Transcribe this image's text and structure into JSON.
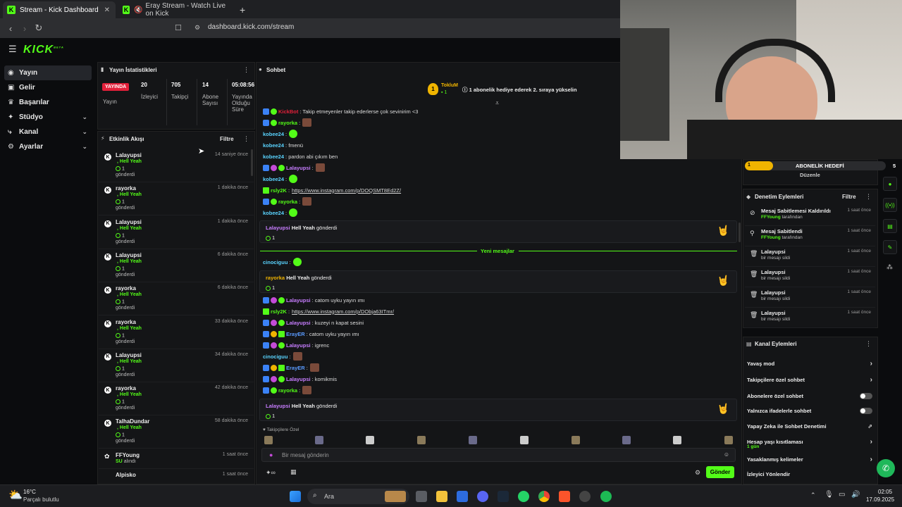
{
  "browser": {
    "tabs": [
      {
        "label": "Stream - Kick Dashboard",
        "active": true
      },
      {
        "label": "Eray Stream - Watch Live on Kick",
        "active": false
      }
    ],
    "url": "dashboard.kick.com/stream"
  },
  "app": {
    "logo": "KICK",
    "logo_sup": "BETA"
  },
  "sidebar": {
    "items": [
      {
        "label": "Yayın",
        "icon": "broadcast-icon",
        "active": true
      },
      {
        "label": "Gelir",
        "icon": "revenue-icon"
      },
      {
        "label": "Başarılar",
        "icon": "trophy-icon"
      },
      {
        "label": "Stüdyo",
        "icon": "studio-icon",
        "chevron": true
      },
      {
        "label": "Kanal",
        "icon": "channel-icon",
        "chevron": true
      },
      {
        "label": "Ayarlar",
        "icon": "gear-icon",
        "chevron": true
      }
    ]
  },
  "stats": {
    "title": "Yayın İstatistikleri",
    "live_badge": "YAYINDA",
    "live_label": "Yayın",
    "viewers": {
      "value": "20",
      "label": "İzleyici"
    },
    "followers": {
      "value": "705",
      "label": "Takipçi"
    },
    "subs": {
      "value": "14",
      "label1": "Abone",
      "label2": "Sayısı"
    },
    "uptime": {
      "value": "05:08:56",
      "label1": "Yayında",
      "label2": "Olduğu",
      "label3": "Süre"
    }
  },
  "activity": {
    "title": "Etkinlik Akışı",
    "filter": "Filtre",
    "rows": [
      {
        "name": "Lalayupsi",
        "sub": ", Hell Yeah",
        "count": "1",
        "sent": "gönderdi",
        "time": "14 saniye önce"
      },
      {
        "name": "rayorka",
        "sub": ", Hell Yeah",
        "count": "1",
        "sent": "gönderdi",
        "time": "1 dakika önce"
      },
      {
        "name": "Lalayupsi",
        "sub": ", Hell Yeah",
        "count": "1",
        "sent": "gönderdi",
        "time": "1 dakika önce"
      },
      {
        "name": "Lalayupsi",
        "sub": ", Hell Yeah",
        "count": "1",
        "sent": "gönderdi",
        "time": "6 dakika önce"
      },
      {
        "name": "rayorka",
        "sub": ", Hell Yeah",
        "count": "1",
        "sent": "gönderdi",
        "time": "6 dakika önce"
      },
      {
        "name": "rayorka",
        "sub": ", Hell Yeah",
        "count": "1",
        "sent": "gönderdi",
        "time": "33 dakika önce"
      },
      {
        "name": "Lalayupsi",
        "sub": ", Hell Yeah",
        "count": "1",
        "sent": "gönderdi",
        "time": "34 dakika önce"
      },
      {
        "name": "rayorka",
        "sub": ", Hell Yeah",
        "count": "1",
        "sent": "gönderdi",
        "time": "42 dakika önce"
      },
      {
        "name": "TalhaDundar",
        "sub": ", Hell Yeah",
        "count": "1",
        "sent": "gönderdi",
        "time": "58 dakika önce"
      }
    ],
    "ffyoung": {
      "name": "FFYoung",
      "sub": "SU",
      "sub2": "alındı",
      "time": "1 saat önce"
    },
    "alpisko": {
      "name": "Alpisko",
      "time": "1 saat önce"
    }
  },
  "chat": {
    "title": "Sohbet",
    "pinned": {
      "user": "TokluM",
      "count": "1",
      "text": "1 abonelik hediye ederek 2. sıraya yükselin"
    },
    "lines": [
      {
        "user": "KickBot",
        "color": "#e2203a",
        "text": ": Takip etmeyenler takip ederlerse çok sevinirim <3",
        "badges": [
          "b-blue",
          "b-green"
        ]
      },
      {
        "user": "rayorka",
        "color": "#53fc18",
        "text": ":",
        "badges": [
          "b-blue",
          "b-green"
        ],
        "emote": "brown"
      },
      {
        "user": "kobee24",
        "color": "#5ad4ff",
        "text": ":",
        "badges": [],
        "emote": "green"
      },
      {
        "user": "kobee24",
        "color": "#5ad4ff",
        "text": ": fmenü",
        "badges": []
      },
      {
        "user": "kobee24",
        "color": "#5ad4ff",
        "text": ": pardon abi çıkım ben",
        "badges": []
      },
      {
        "user": "Lalayupsi",
        "color": "#c77dff",
        "text": ":",
        "badges": [
          "b-blue",
          "b-pink",
          "b-green"
        ],
        "emote": "brown"
      },
      {
        "user": "kobee24",
        "color": "#5ad4ff",
        "text": ":",
        "badges": [],
        "emote": "green"
      },
      {
        "user": "rsly2K",
        "color": "#53fc18",
        "text": ":",
        "badges": [
          "b-gift"
        ],
        "link": "https://www.instagram.com/p/DOQSMT8Ed2Z/"
      },
      {
        "user": "rayorka",
        "color": "#53fc18",
        "text": ":",
        "badges": [
          "b-blue",
          "b-green"
        ],
        "emote": "brown"
      },
      {
        "user": "kobee24",
        "color": "#5ad4ff",
        "text": ":",
        "badges": [],
        "emote": "green"
      }
    ],
    "gift1": {
      "user": "Lalayupsi",
      "item": "Hell Yeah",
      "sent": "gönderdi",
      "count": "1"
    },
    "new_messages": "Yeni mesajlar",
    "line_cino": {
      "user": "cinociguu",
      "color": "#5ad4ff",
      "text": ":"
    },
    "gift2": {
      "user": "rayorka",
      "item": "Hell Yeah",
      "sent": "gönderdi",
      "count": "1"
    },
    "lines2": [
      {
        "user": "Lalayupsi",
        "color": "#c77dff",
        "text": ": catom uyku yayın ımı",
        "badges": [
          "b-blue",
          "b-pink",
          "b-green"
        ]
      },
      {
        "user": "rsly2K",
        "color": "#53fc18",
        "text": ":",
        "badges": [
          "b-gift"
        ],
        "link": "https://www.instagram.com/p/DObja63ITmr/"
      },
      {
        "user": "Lalayupsi",
        "color": "#c77dff",
        "text": ": kuzeyi n kapat sesini",
        "badges": [
          "b-blue",
          "b-pink",
          "b-green"
        ]
      },
      {
        "user": "ErayER",
        "color": "#5a9bff",
        "text": ": catom uyku yayın ımı",
        "badges": [
          "b-blue",
          "b-gold",
          "b-gift"
        ]
      },
      {
        "user": "Lalayupsi",
        "color": "#c77dff",
        "text": ": igrenc",
        "badges": [
          "b-blue",
          "b-pink",
          "b-green"
        ]
      },
      {
        "user": "cinociguu",
        "color": "#5ad4ff",
        "text": ":",
        "badges": [],
        "emote": "brown"
      },
      {
        "user": "ErayER",
        "color": "#5a9bff",
        "text": ":",
        "badges": [
          "b-blue",
          "b-gold",
          "b-gift"
        ],
        "emote": "brown"
      },
      {
        "user": "Lalayupsi",
        "color": "#c77dff",
        "text": ": komikmis",
        "badges": [
          "b-blue",
          "b-pink",
          "b-green"
        ]
      },
      {
        "user": "rayorka",
        "color": "#53fc18",
        "text": ":",
        "badges": [
          "b-blue",
          "b-green"
        ],
        "emote": "brown"
      }
    ],
    "gift3": {
      "user": "Lalayupsi",
      "item": "Hell Yeah",
      "sent": "gönderdi",
      "count": "1"
    },
    "followers_only": "Takipçilere Özel",
    "input_placeholder": "Bir mesaj gönderin",
    "send": "Gönder"
  },
  "sub_goal": {
    "start": "1",
    "title": "ABONELİK HEDEFİ",
    "end": "5",
    "edit": "Düzenle"
  },
  "moderation": {
    "title": "Denetim Eylemleri",
    "filter": "Filtre",
    "rows": [
      {
        "name": "Mesaj Sabitlemesi Kaldırıldı",
        "by": "FFYoung",
        "suffix": "tarafından",
        "time": "1 saat önce",
        "icon": "unpin-icon"
      },
      {
        "name": "Mesaj Sabitlendi",
        "by": "FFYoung",
        "suffix": "tarafından",
        "time": "1 saat önce",
        "icon": "pin-icon"
      },
      {
        "name": "Lalayupsi",
        "by": "",
        "suffix": "bir mesajı sildi",
        "time": "1 saat önce",
        "icon": "trash-icon"
      },
      {
        "name": "Lalayupsi",
        "by": "",
        "suffix": "bir mesajı sildi",
        "time": "1 saat önce",
        "icon": "trash-icon"
      },
      {
        "name": "Lalayupsi",
        "by": "",
        "suffix": "bir mesajı sildi",
        "time": "1 saat önce",
        "icon": "trash-icon"
      },
      {
        "name": "Lalayupsi",
        "by": "",
        "suffix": "bir mesajı sildi",
        "time": "1 saat önce",
        "icon": "trash-icon"
      }
    ]
  },
  "channel_actions": {
    "title": "Kanal Eylemleri",
    "items": [
      {
        "label": "Yavaş mod",
        "kind": "chevron"
      },
      {
        "label": "Takipçilere özel sohbet",
        "kind": "chevron"
      },
      {
        "label": "Abonelere özel sohbet",
        "kind": "toggle"
      },
      {
        "label": "Yalnızca ifadelerle sohbet",
        "kind": "toggle"
      },
      {
        "label": "Yapay Zeka ile Sohbet Denetimi",
        "kind": "external"
      },
      {
        "label": "Hesap yaşı kısıtlaması",
        "sub": "1 gün",
        "kind": "chevron"
      },
      {
        "label": "Yasaklanmış kelimeler",
        "kind": "chevron"
      },
      {
        "label": "İzleyici Yönlendir",
        "kind": "none"
      }
    ]
  },
  "taskbar": {
    "weather_temp": "16°C",
    "weather_desc": "Parçalı bulutlu",
    "search": "Ara",
    "time": "02:05",
    "date": "17.09.2025"
  }
}
